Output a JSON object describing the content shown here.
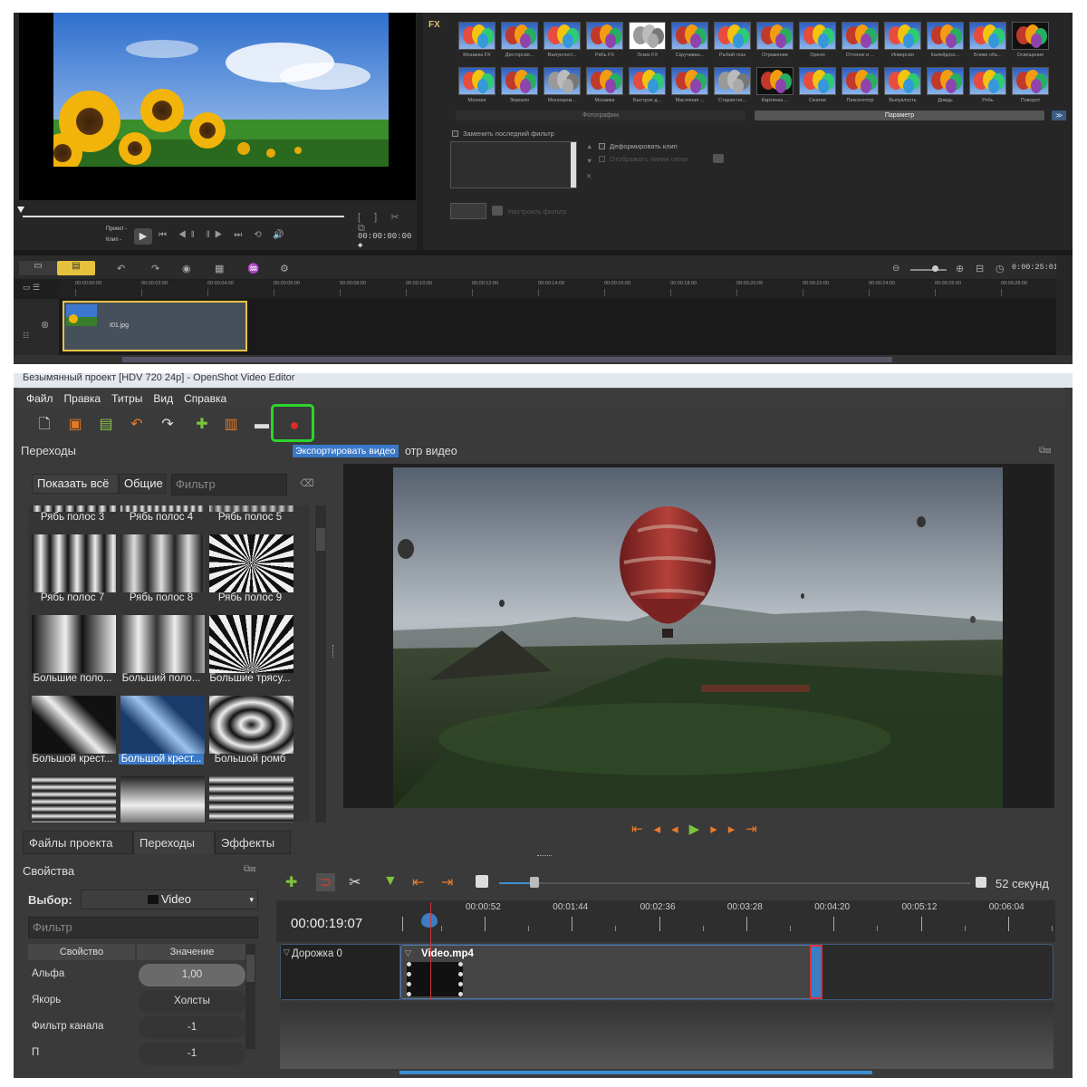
{
  "corel": {
    "player": {
      "project_label": "Проект -",
      "clip_label": "Клип -",
      "timecode": "00:00:00:00 ◆"
    },
    "fx_label": "FX",
    "fx_row1": [
      "Мозаика FX",
      "Дисторсия...",
      "Выпуклост...",
      "Рябь FX",
      "Эскиз FX",
      "Скручиван...",
      "Рыбий глаз",
      "Отражение",
      "Ореол",
      "Оттенок и ...",
      "Инверсия",
      "Калейдоск...",
      "Блики объ...",
      "Освещение"
    ],
    "fx_row2": [
      "Молния",
      "Зеркало",
      "Монохром...",
      "Мозаика",
      "Быстрое д...",
      "Масляная ...",
      "Старая пл...",
      "Картинка ...",
      "Сжатие",
      "Пикселятор",
      "Выпуклость",
      "Дождь",
      "Рябь",
      "Поворот"
    ],
    "tabs": {
      "photos": "Фотографии",
      "params": "Параметр"
    },
    "options": {
      "replace_last_filter": "Заменить последний фильтр",
      "deform_clip": "Деформировать клип",
      "show_grid": "Отображать линии сетки",
      "configure_filter": "Настроить фильтр"
    },
    "timecode": "0:00:25:01",
    "ruler": [
      "00:00:00:00",
      "00:00:02:00",
      "00:00:04:00",
      "00:00:06:00",
      "00:00:08:00",
      "00:00:10:00",
      "00:00:12:00",
      "00:00:14:00",
      "00:00:16:00",
      "00:00:18:00",
      "00:00:20:00",
      "00:00:22:00",
      "00:00:24:00",
      "00:00:26:00",
      "00:00:28:00"
    ],
    "clip_name": "I01.jpg"
  },
  "openshot": {
    "window_title": "Безымянный проект [HDV 720 24p] - OpenShot Video Editor",
    "menu": [
      "Файл",
      "Правка",
      "Титры",
      "Вид",
      "Справка"
    ],
    "tooltip": "Экспортировать видео",
    "preview_title": "отр видео",
    "left_title": "Переходы",
    "filter_buttons": {
      "show_all": "Показать всё",
      "common": "Общие"
    },
    "filter_placeholder": "Фильтр",
    "transitions": [
      "Рябь полос 3",
      "Рябь полос 4",
      "Рябь полос 5",
      "Рябь полос 7",
      "Рябь полос 8",
      "Рябь полос 9",
      "Большие поло...",
      "Больший поло...",
      "Большие трясу...",
      "Большой крест...",
      "Большой крест...",
      "Большой ромб",
      "",
      "",
      ""
    ],
    "selected_transition_index": 10,
    "tabs": [
      "Файлы проекта",
      "Переходы",
      "Эффекты"
    ],
    "active_tab_index": 1,
    "properties": {
      "title": "Свойства",
      "selection_label": "Выбор:",
      "selection_value": "Video",
      "filter_placeholder": "Фильтр",
      "col_property": "Свойство",
      "col_value": "Значение",
      "rows": [
        {
          "name": "Альфа",
          "value": "1,00"
        },
        {
          "name": "Якорь",
          "value": "Холсты"
        },
        {
          "name": "Фильтр канала",
          "value": "-1"
        },
        {
          "name": "П",
          "value": "-1"
        }
      ]
    },
    "timeline": {
      "current_time": "00:00:19:07",
      "zoom_label": "52 секунд",
      "ruler": [
        "00:00:52",
        "00:01:44",
        "00:02:36",
        "00:03:28",
        "00:04:20",
        "00:05:12",
        "00:06:04"
      ],
      "track_name": "Дорожка 0",
      "clip_name": "Video.mp4"
    }
  },
  "colors": {
    "export_highlight": "#2bd52b",
    "selection": "#3a78c8",
    "transport": "#e8792a",
    "corel_clip_border": "#e8c246"
  }
}
